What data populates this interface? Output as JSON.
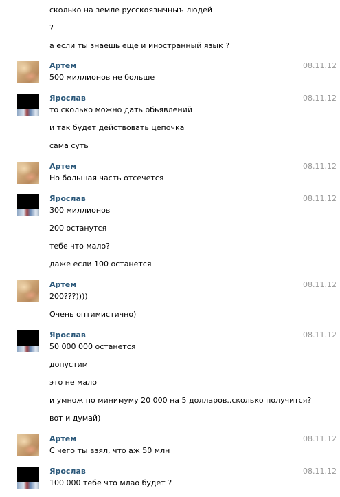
{
  "colors": {
    "name": "#2b587a",
    "date": "#999999",
    "text": "#000000"
  },
  "leading_lines": [
    "сколько на земле русскоязычныъ людей",
    "?",
    "а если ты знаешь еще и иностранный язык ?"
  ],
  "messages": [
    {
      "author": "Артем",
      "date": "08.11.12",
      "lines": [
        "500 миллионов не больше"
      ]
    },
    {
      "author": "Ярослав",
      "date": "08.11.12",
      "lines": [
        "то сколько можно дать обьявлений",
        "и так будет действовать цепочка",
        "сама суть"
      ]
    },
    {
      "author": "Артем",
      "date": "08.11.12",
      "lines": [
        "Но большая часть отсечется"
      ]
    },
    {
      "author": "Ярослав",
      "date": "08.11.12",
      "lines": [
        "300 миллионов",
        "200 останутся",
        "тебе что мало?",
        "даже если 100 останется"
      ]
    },
    {
      "author": "Артем",
      "date": "08.11.12",
      "lines": [
        "200???))))",
        "Очень оптимистично)"
      ]
    },
    {
      "author": "Ярослав",
      "date": "08.11.12",
      "lines": [
        "50 000 000 останется",
        "допустим",
        "это не мало",
        "и умнож по минимуму 20 000 на 5 долларов..сколько получится?",
        "вот и думай)"
      ]
    },
    {
      "author": "Артем",
      "date": "08.11.12",
      "lines": [
        "С чего ты взял, что аж 50 млн"
      ]
    },
    {
      "author": "Ярослав",
      "date": "08.11.12",
      "lines": [
        "100 000 тебе что млао будет ?"
      ]
    }
  ]
}
